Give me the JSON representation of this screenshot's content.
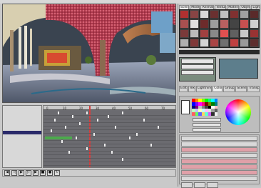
{
  "window": {
    "title": ""
  },
  "library": {
    "tabs": [
      "Scenes",
      "Models",
      "Animation",
      "Textures",
      "Materials",
      "Objects",
      "Lights"
    ],
    "thumb_colors": [
      "#b03030",
      "#884444",
      "#d9d9d9",
      "#6a3030",
      "#c0c0c0",
      "#803030",
      "#a0a0a0",
      "#5a2a2a",
      "#a85050",
      "#e0e0e0",
      "#6d2b2b",
      "#9e9e9e",
      "#b86060",
      "#444444",
      "#c85050",
      "#d0d0d0",
      "#7a3a3a",
      "#bbbbbb",
      "#a04040",
      "#888888",
      "#e05050",
      "#606060",
      "#c7c7c7",
      "#993333",
      "#b0b0b0",
      "#803838",
      "#d4d4d4",
      "#aa4444",
      "#707070",
      "#c04040",
      "#999999",
      "#5e2e2e"
    ]
  },
  "materials": {
    "tabs": [
      "Edit",
      "Tex",
      "Lightning",
      "Color",
      "Group",
      "Scene",
      "Transp"
    ],
    "rows": [
      "",
      "",
      ""
    ]
  },
  "color_panel": {
    "palette": [
      "#ff0000",
      "#ff8000",
      "#ffff00",
      "#80ff00",
      "#00ff00",
      "#00ff80",
      "#00ffff",
      "#0080ff",
      "#0000ff",
      "#8000ff",
      "#ff00ff",
      "#ff0080",
      "#800000",
      "#808000",
      "#008000",
      "#008080",
      "#000080",
      "#800080",
      "#c0c0c0",
      "#808080",
      "#404040",
      "#000000",
      "#ffffff",
      "#ffc0c0",
      "#c0ffc0",
      "#c0c0ff",
      "#ffffc0",
      "#c0ffff",
      "#ffc0ff",
      "#e0e0e0",
      "#a0a0a0",
      "#606060",
      "#ff6060",
      "#60ff60",
      "#6060ff",
      "#ffd060",
      "#60ffd0",
      "#d060ff",
      "#303030",
      "#f0f0f0"
    ]
  },
  "timeline": {
    "ticks": [
      "0",
      "10",
      "20",
      "30",
      "40",
      "50",
      "60",
      "70"
    ]
  },
  "outliner": {
    "items": [
      "",
      "",
      "",
      "",
      "",
      "",
      "",
      "",
      "",
      "",
      "",
      "",
      "",
      "",
      ""
    ]
  },
  "colors": {
    "accent": "#2a2a6a",
    "key_green": "#4caa4c",
    "panel_bg": "#c4c4c4"
  }
}
